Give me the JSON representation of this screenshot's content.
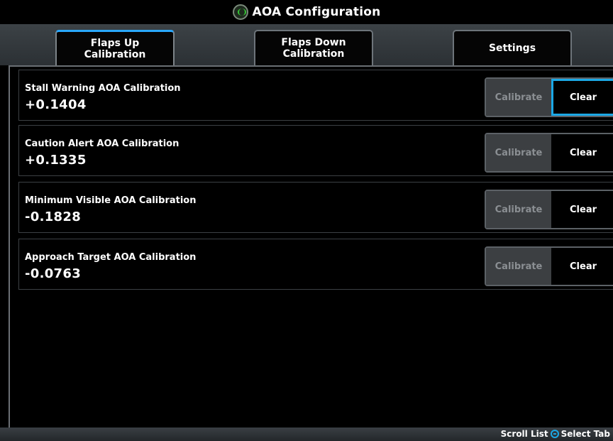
{
  "window": {
    "title": "AOA Configuration"
  },
  "tabs": [
    {
      "label": "Flaps Up\nCalibration",
      "active": true
    },
    {
      "label": "Flaps Down\nCalibration",
      "active": false
    },
    {
      "label": "Settings",
      "active": false
    }
  ],
  "rows": [
    {
      "label": "Stall Warning AOA Calibration",
      "value": "+0.1404",
      "calibrate": "Calibrate",
      "clear": "Clear"
    },
    {
      "label": "Caution Alert AOA Calibration",
      "value": "+0.1335",
      "calibrate": "Calibrate",
      "clear": "Clear"
    },
    {
      "label": "Minimum Visible AOA Calibration",
      "value": "-0.1828",
      "calibrate": "Calibrate",
      "clear": "Clear"
    },
    {
      "label": "Approach Target AOA Calibration",
      "value": "-0.0763",
      "calibrate": "Calibrate",
      "clear": "Clear"
    }
  ],
  "status": {
    "scroll_label": "Scroll List",
    "select_label": "Select Tab"
  },
  "colors": {
    "accent": "#1ba8e6",
    "disabled_button": "#3c3f42",
    "tab_bar": "#3c4246"
  },
  "icons": {
    "app": "aoa-icon",
    "knob": "knob-icon"
  }
}
